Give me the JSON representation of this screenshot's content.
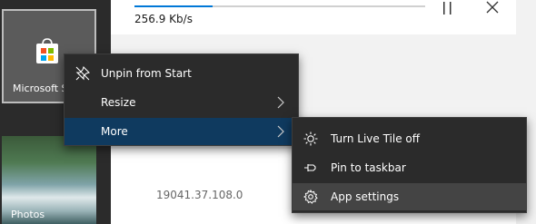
{
  "download": {
    "progress": 0.27,
    "speed": "256.9 Kb/s"
  },
  "app_info": {
    "version": "19041.37.108.0"
  },
  "tiles": {
    "store": {
      "label": "Microsoft Store"
    },
    "photos": {
      "label": "Photos"
    }
  },
  "context_menu": {
    "unpin": "Unpin from Start",
    "resize": "Resize",
    "more": "More"
  },
  "more_submenu": {
    "live_tile": "Turn Live Tile off",
    "pin_taskbar": "Pin to taskbar",
    "app_settings": "App settings"
  },
  "colors": {
    "accent": "#0078d7",
    "menu_bg": "#2b2b2b",
    "menu_active": "#0f3a5f"
  }
}
